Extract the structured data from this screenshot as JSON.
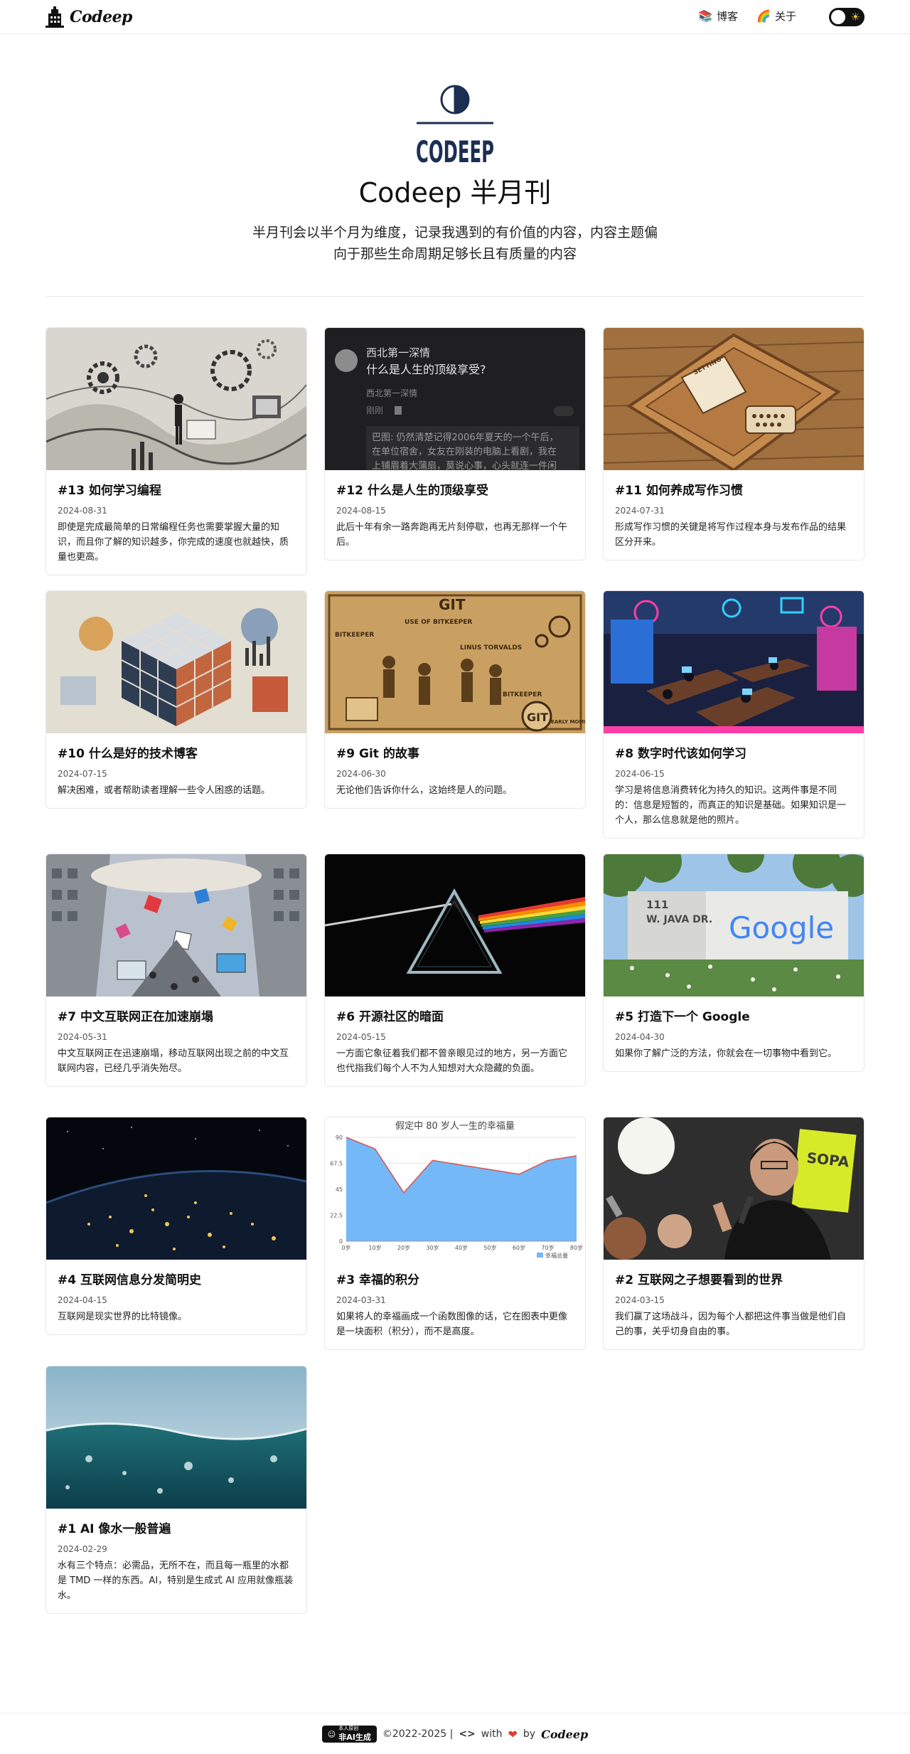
{
  "header": {
    "logo_text": "Codeep",
    "nav": [
      {
        "emoji": "📚",
        "label": "博客"
      },
      {
        "emoji": "🌈",
        "label": "关于"
      }
    ],
    "theme_icon": "☀"
  },
  "hero": {
    "logo_text": "CODEEP",
    "title": "Codeep 半月刊",
    "description": "半月刊会以半个月为维度，记录我遇到的有价值的内容，内容主题偏向于那些生命周期足够长且有质量的内容"
  },
  "posts": [
    {
      "title": "#13 如何学习编程",
      "date": "2024-08-31",
      "excerpt": "即使是完成最简单的日常编程任务也需要掌握大量的知识，而且你了解的知识越多，你完成的速度也就越快，质量也更高。"
    },
    {
      "title": "#12 什么是人生的顶级享受",
      "date": "2024-08-15",
      "excerpt": "此后十年有余一路奔跑再无片刻停歇，也再无那样一个午后。"
    },
    {
      "title": "#11 如何养成写作习惯",
      "date": "2024-07-31",
      "excerpt": "形成写作习惯的关键是将写作过程本身与发布作品的结果区分开来。"
    },
    {
      "title": "#10 什么是好的技术博客",
      "date": "2024-07-15",
      "excerpt": "解决困难，或者帮助读者理解一些令人困惑的话题。"
    },
    {
      "title": "#9 Git 的故事",
      "date": "2024-06-30",
      "excerpt": "无论他们告诉你什么，这始终是人的问题。"
    },
    {
      "title": "#8 数字时代该如何学习",
      "date": "2024-06-15",
      "excerpt": "学习是将信息消费转化为持久的知识。这两件事是不同的：信息是短暂的，而真正的知识是基础。如果知识是一个人，那么信息就是他的照片。"
    },
    {
      "title": "#7 中文互联网正在加速崩塌",
      "date": "2024-05-31",
      "excerpt": "中文互联网正在迅速崩塌，移动互联网出现之前的中文互联网内容，已经几乎消失殆尽。"
    },
    {
      "title": "#6 开源社区的暗面",
      "date": "2024-05-15",
      "excerpt": "一方面它象征着我们都不曾亲眼见过的地方，另一方面它也代指我们每个人不为人知想对大众隐藏的负面。"
    },
    {
      "title": "#5 打造下一个 Google",
      "date": "2024-04-30",
      "excerpt": "如果你了解广泛的方法，你就会在一切事物中看到它。"
    },
    {
      "title": "#4 互联网信息分发简明史",
      "date": "2024-04-15",
      "excerpt": "互联网是现实世界的比特镜像。"
    },
    {
      "title": "#3 幸福的积分",
      "date": "2024-03-31",
      "excerpt": "如果将人的幸福画成一个函数图像的话，它在图表中更像是一块面积（积分），而不是高度。"
    },
    {
      "title": "#2 互联网之子想要看到的世界",
      "date": "2024-03-15",
      "excerpt": "我们赢了这场战斗，因为每个人都把这件事当做是他们自己的事，关乎切身自由的事。"
    },
    {
      "title": "#1 AI 像水一般普遍",
      "date": "2024-02-29",
      "excerpt": "水有三个特点：必需品，无所不在，而且每一瓶里的水都是 TMD 一样的东西。AI，特别是生成式 AI 应用就像瓶装水。"
    }
  ],
  "thumbs": {
    "p12": {
      "author": "西北第一深情",
      "question": "什么是人生的顶级享受?",
      "byline": "西北第一深情",
      "meta": "刚刚",
      "quote_line1": "巴图: 仍然清楚记得2006年夏天的一个午后，",
      "quote_line2": "在单位宿舍，女友在刚装的电脑上看剧，我在",
      "quote_line3": "上铺眉着大蒲扇，莫说心事，心头就连一件闲"
    },
    "p11": {
      "paper_label": "SETTING"
    },
    "p9": {
      "labels": [
        "GIT",
        "USE OF BITKEEPER",
        "BITKEEPER",
        "LINUS TORVALDS",
        "BITKEEPER",
        "GIT",
        "EARLY MOMENTS"
      ]
    },
    "p5": {
      "sign_address_1": "111",
      "sign_address_2": "W. JAVA DR.",
      "sign_logo": "Google"
    },
    "p2": {
      "sign_text": "SOPA"
    }
  },
  "chart_data": {
    "type": "area",
    "title": "假定中 80 岁人一生的幸福量",
    "categories": [
      "0岁",
      "10岁",
      "20岁",
      "30岁",
      "40岁",
      "50岁",
      "60岁",
      "70岁",
      "80岁"
    ],
    "series": [
      {
        "name": "幸福总量",
        "values": [
          90,
          80,
          42,
          70,
          66,
          62,
          58,
          70,
          74
        ]
      }
    ],
    "yticks": [
      0,
      22.5,
      45,
      67.5,
      90
    ],
    "ylim": [
      0,
      90
    ],
    "xlabel": "",
    "ylabel": "",
    "legend": "bottom-right",
    "grid": true,
    "fill_color": "#74b8f7",
    "line_color": "#d9534f"
  },
  "footer": {
    "badge_small": "本人原创",
    "badge_main": "非AI生成",
    "copyright": "©2022-2025 |",
    "code_icon": "<>",
    "with": "with",
    "heart": "❤",
    "by": "by",
    "brand": "Codeep"
  },
  "colors": {
    "accent": "#111111",
    "navy": "#1c2f52",
    "heart": "#e23a3a"
  }
}
